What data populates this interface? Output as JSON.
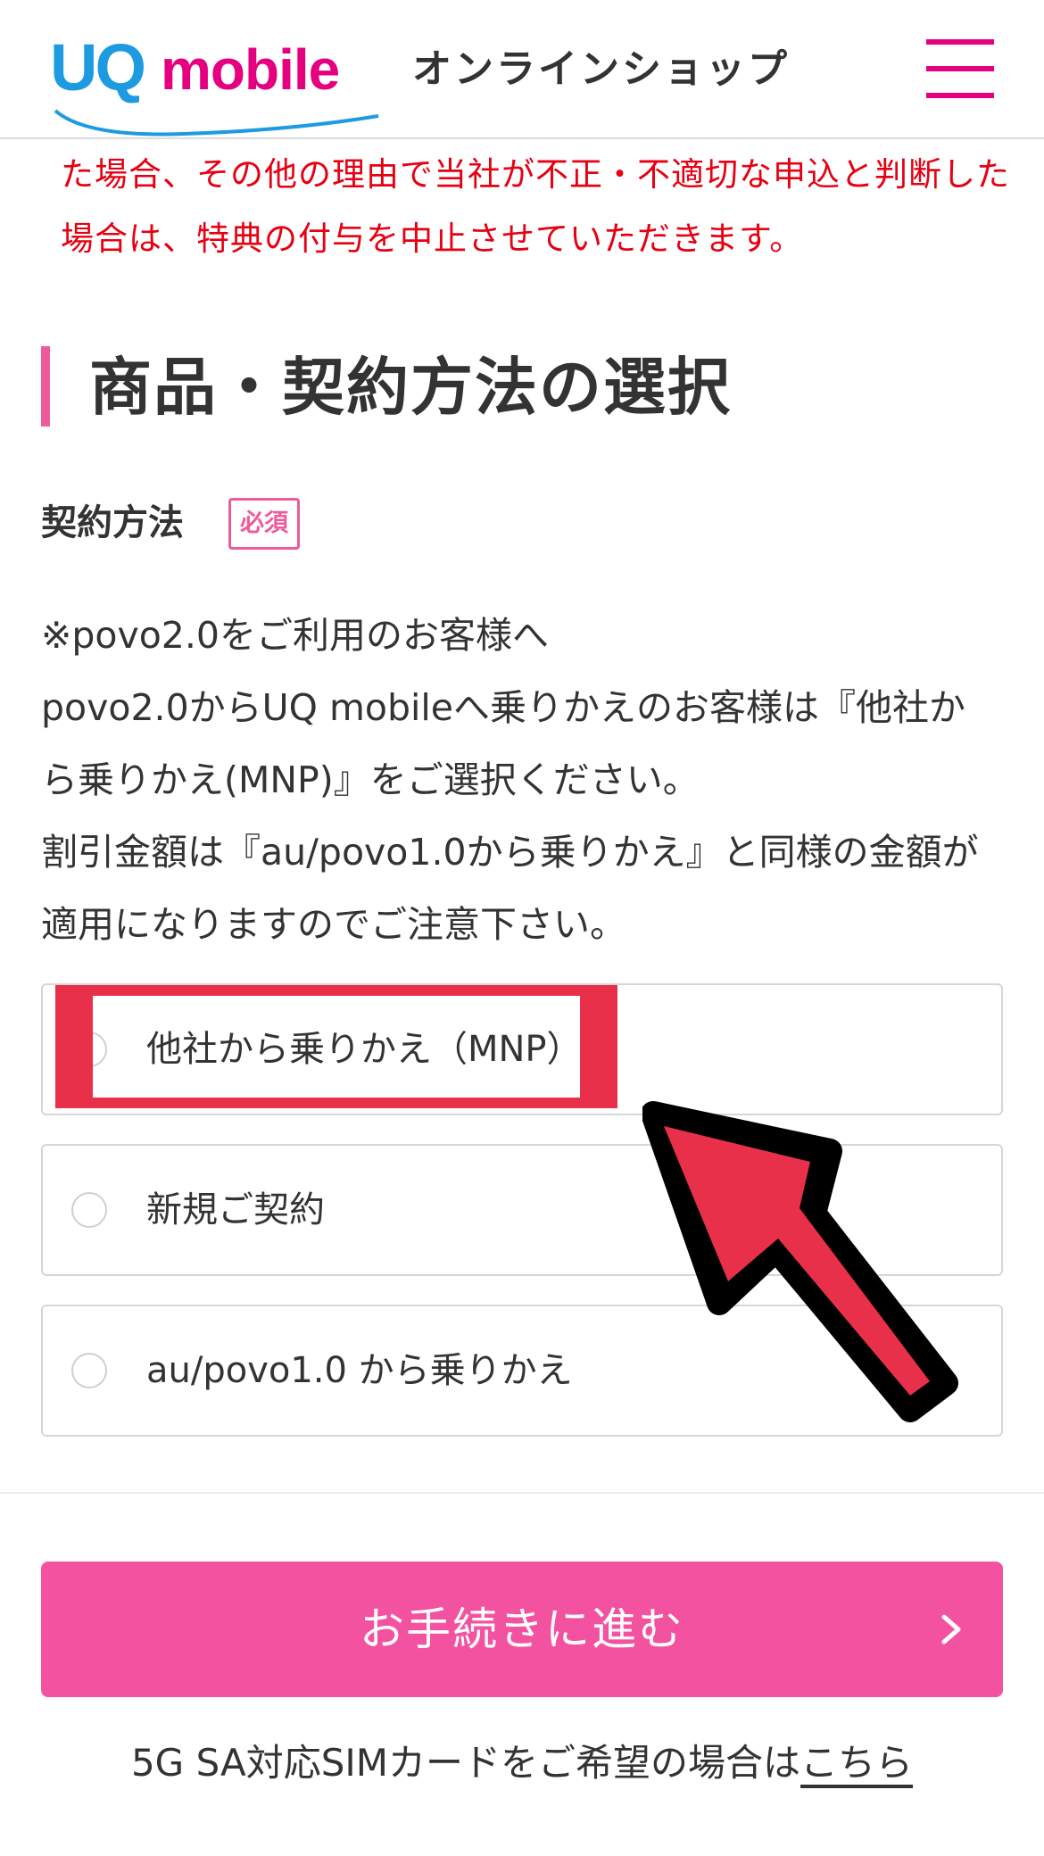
{
  "header": {
    "logo_uq": "UQ",
    "logo_mobile": "mobile",
    "shop_label": "オンラインショップ",
    "menu_icon": "hamburger-menu-icon",
    "brand_colors": {
      "uq": "#1e9be0",
      "mobile": "#e4007f",
      "menu": "#e4007f"
    }
  },
  "notice": {
    "line1": "た場合、その他の理由で当社が不正・不適切な申込と判断した",
    "line2": "場合は、特典の付与を中止させていただきます。",
    "color": "#e60012"
  },
  "section": {
    "title": "商品・契約方法の選択",
    "accent_color": "#ee5b9d"
  },
  "contract": {
    "label": "契約方法",
    "required_badge": "必須",
    "info_lines": [
      "※povo2.0をご利用のお客様へ",
      "povo2.0からUQ mobileへ乗りかえのお客様は『他社か",
      "ら乗りかえ(MNP)』をご選択ください。",
      "割引金額は『au/povo1.0から乗りかえ』と同様の金額が",
      "適用になりますのでご注意下さい。"
    ],
    "options": [
      {
        "label": "他社から乗りかえ（MNP）",
        "selected": false
      },
      {
        "label": "新規ご契約",
        "selected": false
      },
      {
        "label": "au/povo1.0 から乗りかえ",
        "selected": false
      }
    ]
  },
  "proceed_button": {
    "label": "お手続きに進む",
    "icon": "chevron-right-icon",
    "color": "#f352a1"
  },
  "footer": {
    "text": "5G SA対応SIMカードをご希望の場合は",
    "link_text": "こちら"
  },
  "annotation": {
    "highlight_color": "#e8304a",
    "arrow_icon": "pointing-arrow-icon"
  }
}
